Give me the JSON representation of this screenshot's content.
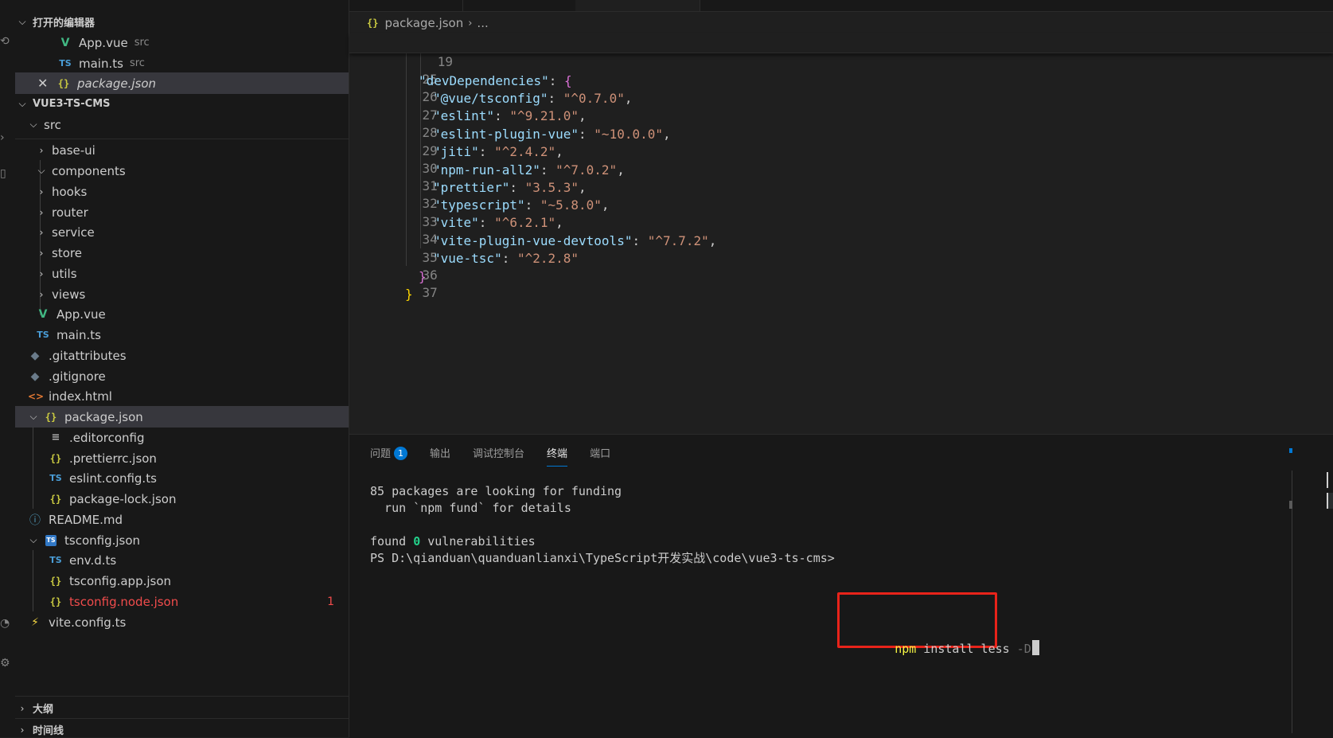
{
  "explorer": {
    "open_editors": {
      "title": "打开的编辑器",
      "items": [
        {
          "name": "App.vue",
          "hint": "src"
        },
        {
          "name": "main.ts",
          "hint": "src"
        },
        {
          "name": "package.json",
          "hint": ""
        }
      ]
    },
    "project": {
      "title": "VUE3-TS-CMS",
      "tree": [
        {
          "label": "src"
        },
        {
          "label": "base-ui"
        },
        {
          "label": "components"
        },
        {
          "label": "hooks"
        },
        {
          "label": "router"
        },
        {
          "label": "service"
        },
        {
          "label": "store"
        },
        {
          "label": "utils"
        },
        {
          "label": "views"
        },
        {
          "label": "App.vue"
        },
        {
          "label": "main.ts"
        },
        {
          "label": ".gitattributes"
        },
        {
          "label": ".gitignore"
        },
        {
          "label": "index.html"
        },
        {
          "label": "package.json"
        },
        {
          "label": ".editorconfig"
        },
        {
          "label": ".prettierrc.json"
        },
        {
          "label": "eslint.config.ts"
        },
        {
          "label": "package-lock.json"
        },
        {
          "label": "README.md"
        },
        {
          "label": "tsconfig.json"
        },
        {
          "label": "env.d.ts"
        },
        {
          "label": "tsconfig.app.json"
        },
        {
          "label": "tsconfig.node.json",
          "problems": "1"
        },
        {
          "label": "vite.config.ts"
        }
      ]
    },
    "outline_title": "大纲",
    "timeline_title": "时间线"
  },
  "editor": {
    "breadcrumb": {
      "file": "package.json",
      "more": "..."
    },
    "sticky_line": {
      "number": "19",
      "key": "\"devDependencies\"",
      "rest": ": {"
    },
    "lines": [
      {
        "number": "25",
        "key": "\"@vue/tsconfig\"",
        "value": "\"^0.7.0\"",
        "tail": ","
      },
      {
        "number": "26",
        "key": "\"eslint\"",
        "value": "\"^9.21.0\"",
        "tail": ","
      },
      {
        "number": "27",
        "key": "\"eslint-plugin-vue\"",
        "value": "\"~10.0.0\"",
        "tail": ","
      },
      {
        "number": "28",
        "key": "\"jiti\"",
        "value": "\"^2.4.2\"",
        "tail": ","
      },
      {
        "number": "29",
        "key": "\"npm-run-all2\"",
        "value": "\"^7.0.2\"",
        "tail": ","
      },
      {
        "number": "30",
        "key": "\"prettier\"",
        "value": "\"3.5.3\"",
        "tail": ","
      },
      {
        "number": "31",
        "key": "\"typescript\"",
        "value": "\"~5.8.0\"",
        "tail": ","
      },
      {
        "number": "32",
        "key": "\"vite\"",
        "value": "\"^6.2.1\"",
        "tail": ","
      },
      {
        "number": "33",
        "key": "\"vite-plugin-vue-devtools\"",
        "value": "\"^7.7.2\"",
        "tail": ","
      },
      {
        "number": "34",
        "key": "\"vue-tsc\"",
        "value": "\"^2.2.8\"",
        "tail": ""
      }
    ],
    "closing": [
      {
        "number": "35",
        "text": "}"
      },
      {
        "number": "36",
        "text": "}"
      },
      {
        "number": "37",
        "text": ""
      }
    ]
  },
  "panel": {
    "tabs": [
      {
        "label": "问题",
        "badge": "1"
      },
      {
        "label": "输出"
      },
      {
        "label": "调试控制台"
      },
      {
        "label": "终端",
        "active": true
      },
      {
        "label": "端口"
      }
    ],
    "terminal": {
      "line1": "85 packages are looking for funding",
      "line2": "  run `npm fund` for details",
      "found_prefix": "found ",
      "found_count": "0",
      "found_suffix": " vulnerabilities",
      "prompt": "PS D:\\qianduan\\quanduanlianxi\\TypeScript开发实战\\code\\vue3-ts-cms>",
      "command": {
        "bin": "npm",
        "args": " install less ",
        "flag": "-D"
      }
    }
  },
  "colors": {
    "accent": "#0078d4",
    "error": "#f14c4c",
    "highlight_box": "#e8231a"
  }
}
